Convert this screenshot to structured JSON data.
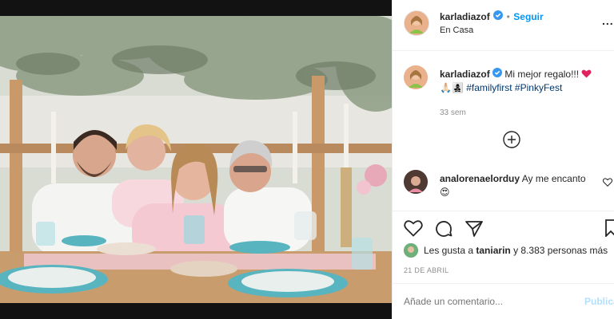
{
  "post_header": {
    "username": "karladiazof",
    "follow_label": "Seguir",
    "location": "En Casa",
    "more_label": "..."
  },
  "caption": {
    "username": "karladiazof",
    "text": "Mi mejor regalo!!!",
    "emoji_line": "🙏🏻👩‍👧‍👦",
    "hashtags": [
      "#familyfirst",
      "#PinkyFest"
    ],
    "time": "33 sem"
  },
  "comment": {
    "username": "analorenaelorduy",
    "text": "Ay me encanto",
    "emoji": "😍"
  },
  "likes": {
    "prefix": "Les gusta a",
    "user": "taniarin",
    "suffix": "y 8.383 personas más"
  },
  "date": "21 DE ABRIL",
  "add_comment": {
    "placeholder": "Añade un comentario...",
    "publish_label": "Publicar"
  },
  "colors": {
    "accent": "#0095f6",
    "heart": "#ed4956",
    "text": "#262626",
    "muted": "#8e8e8e",
    "hashtag": "#00376b"
  },
  "icons": [
    "heart-icon",
    "comment-icon",
    "share-icon",
    "bookmark-icon",
    "add-circle-icon",
    "verified-icon",
    "more-icon",
    "like-comment-heart-icon"
  ]
}
